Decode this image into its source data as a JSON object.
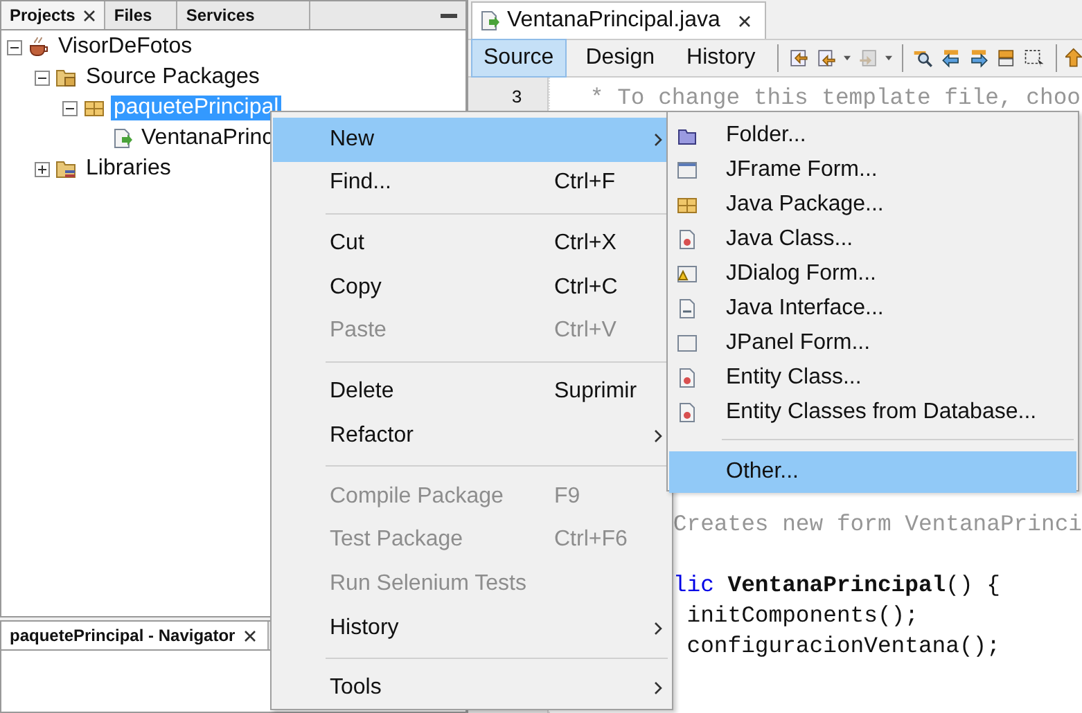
{
  "projects_panel": {
    "tabs": [
      {
        "label": "Projects",
        "selected": true,
        "closable": true
      },
      {
        "label": "Files",
        "selected": false,
        "closable": false
      },
      {
        "label": "Services",
        "selected": false,
        "closable": false
      }
    ],
    "tree": [
      {
        "label": "VisorDeFotos",
        "kind": "project",
        "expanded": true,
        "selected": false,
        "children": [
          {
            "label": "Source Packages",
            "kind": "source",
            "expanded": true,
            "selected": false,
            "children": [
              {
                "label": "paquetePrincipal",
                "kind": "package",
                "expanded": true,
                "selected": true,
                "children": [
                  {
                    "label": "VentanaPrinc",
                    "kind": "form",
                    "selected": false
                  }
                ]
              }
            ]
          },
          {
            "label": "Libraries",
            "kind": "library",
            "expanded": false,
            "selected": false
          }
        ]
      }
    ]
  },
  "navigator_panel": {
    "title": "paquetePrincipal - Navigator"
  },
  "editor": {
    "file_tab": "VentanaPrincipal.java",
    "view_tabs": [
      {
        "label": "Source",
        "selected": true
      },
      {
        "label": "Design",
        "selected": false
      },
      {
        "label": "History",
        "selected": false
      }
    ],
    "lines": [
      {
        "number": "3",
        "kind": "comment",
        "segments": [
          {
            "text": "* To change this template file, choo",
            "kind": "comment"
          }
        ]
      },
      {
        "kind": "blank"
      },
      {
        "kind": "blank"
      },
      {
        "kind": "blank"
      },
      {
        "kind": "blank"
      },
      {
        "kind": "blank"
      },
      {
        "kind": "blank"
      },
      {
        "kind": "blank"
      },
      {
        "kind": "blank"
      },
      {
        "kind": "blank"
      },
      {
        "kind": "blank"
      },
      {
        "kind": "blank"
      },
      {
        "kind": "blank"
      },
      {
        "kind": "blank"
      },
      {
        "kind": "clipped",
        "segments": [
          {
            "text": "Creates new form VentanaPrinci",
            "kind": "comment"
          }
        ]
      },
      {
        "kind": "blank"
      },
      {
        "kind": "clipped",
        "segments": [
          {
            "text": "lic",
            "kind": "keyword"
          },
          {
            "text": " VentanaPrincipal",
            "kind": "name"
          },
          {
            "text": "() {",
            "kind": "code"
          }
        ]
      },
      {
        "kind": "clipped",
        "segments": [
          {
            "text": " initComponents();",
            "kind": "code"
          }
        ]
      },
      {
        "kind": "clipped",
        "segments": [
          {
            "text": " configuracionVentana();",
            "kind": "code"
          }
        ]
      }
    ]
  },
  "context_menu": {
    "items": [
      {
        "kind": "item",
        "label": "New",
        "submenu": true,
        "highlighted": true,
        "disabled": false
      },
      {
        "kind": "item",
        "label": "Find...",
        "shortcut": "Ctrl+F",
        "submenu": false,
        "highlighted": false,
        "disabled": false
      },
      {
        "kind": "separator"
      },
      {
        "kind": "item",
        "label": "Cut",
        "shortcut": "Ctrl+X",
        "submenu": false,
        "highlighted": false,
        "disabled": false
      },
      {
        "kind": "item",
        "label": "Copy",
        "shortcut": "Ctrl+C",
        "submenu": false,
        "highlighted": false,
        "disabled": false
      },
      {
        "kind": "item",
        "label": "Paste",
        "shortcut": "Ctrl+V",
        "submenu": false,
        "highlighted": false,
        "disabled": true
      },
      {
        "kind": "separator"
      },
      {
        "kind": "item",
        "label": "Delete",
        "shortcut": "Suprimir",
        "submenu": false,
        "highlighted": false,
        "disabled": false
      },
      {
        "kind": "item",
        "label": "Refactor",
        "submenu": true,
        "highlighted": false,
        "disabled": false
      },
      {
        "kind": "separator"
      },
      {
        "kind": "item",
        "label": "Compile Package",
        "shortcut": "F9",
        "submenu": false,
        "highlighted": false,
        "disabled": true
      },
      {
        "kind": "item",
        "label": "Test Package",
        "shortcut": "Ctrl+F6",
        "submenu": false,
        "highlighted": false,
        "disabled": true
      },
      {
        "kind": "item",
        "label": "Run Selenium Tests",
        "submenu": false,
        "highlighted": false,
        "disabled": true
      },
      {
        "kind": "item",
        "label": "History",
        "submenu": true,
        "highlighted": false,
        "disabled": false
      },
      {
        "kind": "separator"
      },
      {
        "kind": "item",
        "label": "Tools",
        "submenu": true,
        "highlighted": false,
        "disabled": false
      }
    ]
  },
  "new_submenu": {
    "items": [
      {
        "kind": "folder",
        "label": "Folder...",
        "highlighted": false
      },
      {
        "kind": "frame",
        "label": "JFrame Form...",
        "highlighted": false
      },
      {
        "kind": "package",
        "label": "Java Package...",
        "highlighted": false
      },
      {
        "kind": "class",
        "label": "Java Class...",
        "highlighted": false
      },
      {
        "kind": "dialog",
        "label": "JDialog Form...",
        "highlighted": false
      },
      {
        "kind": "interface",
        "label": "Java Interface...",
        "highlighted": false
      },
      {
        "kind": "panel",
        "label": "JPanel Form...",
        "highlighted": false
      },
      {
        "kind": "entity",
        "label": "Entity Class...",
        "highlighted": false
      },
      {
        "kind": "entity",
        "label": "Entity Classes from Database...",
        "highlighted": false
      },
      {
        "kind": "separator"
      },
      {
        "kind": "other",
        "label": "Other...",
        "highlighted": true
      }
    ]
  }
}
